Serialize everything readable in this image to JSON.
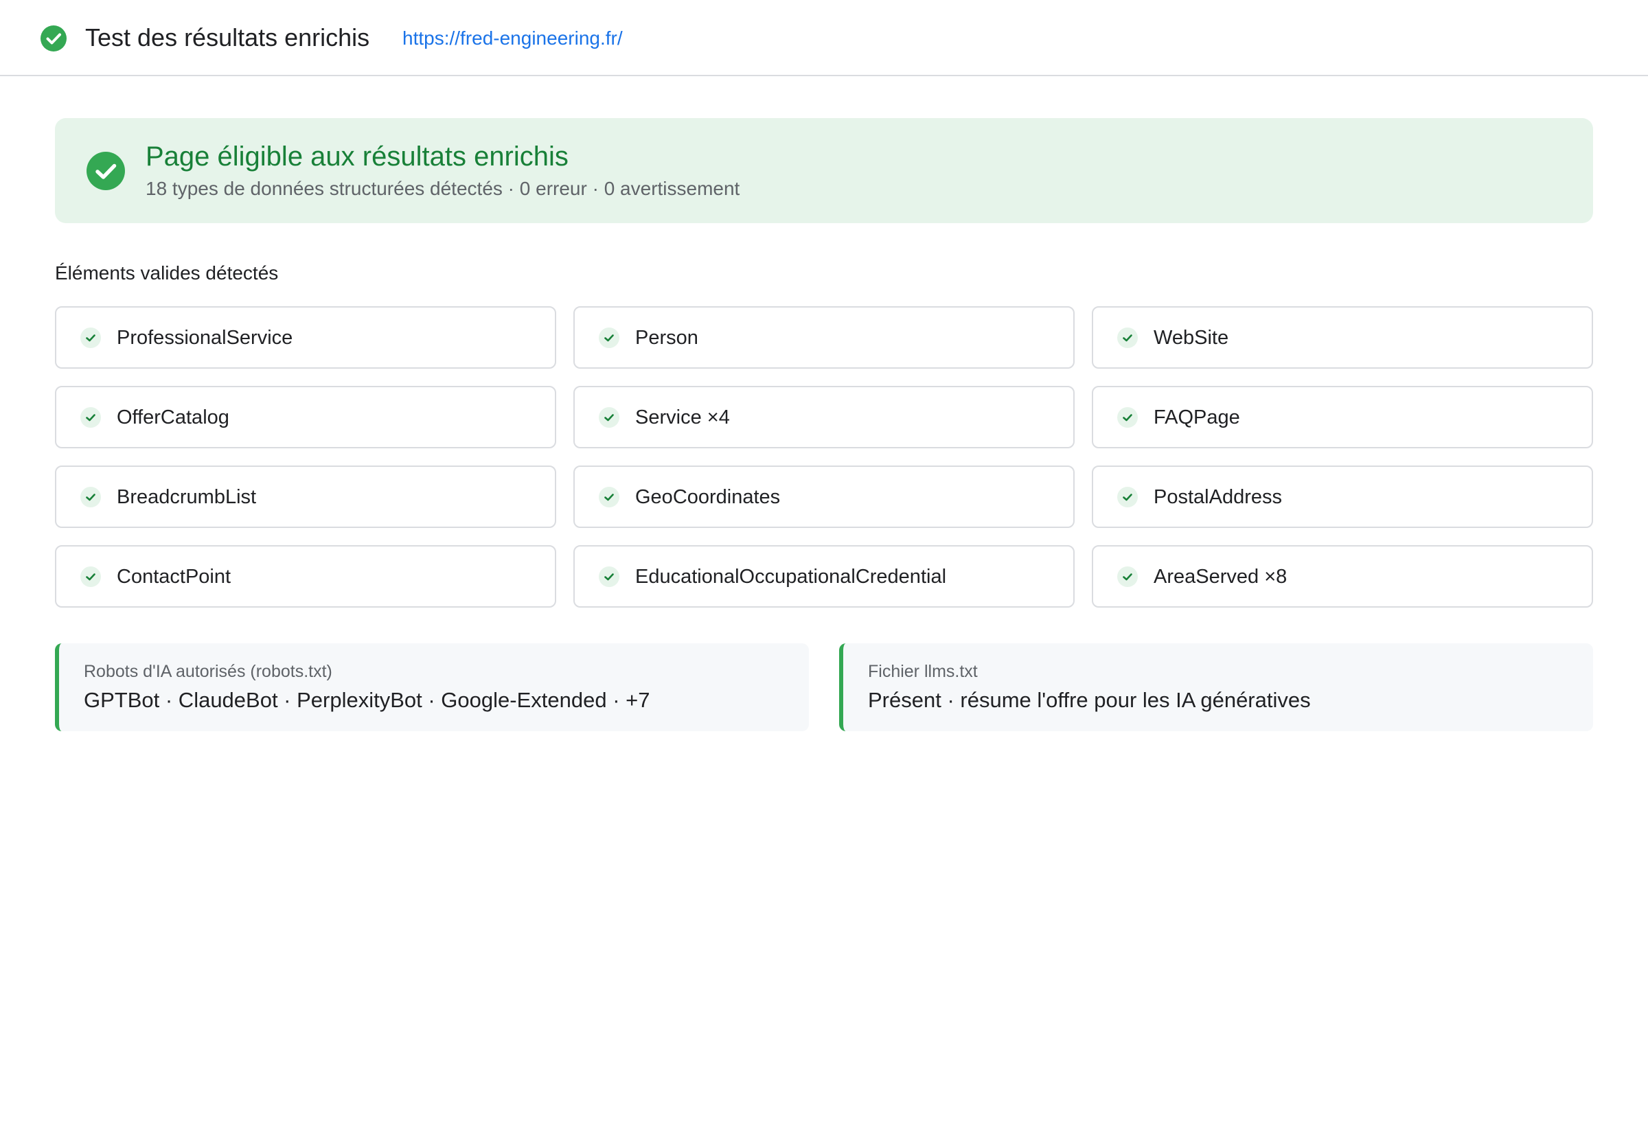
{
  "header": {
    "title": "Test des résultats enrichis",
    "url": "https://fred-engineering.fr/"
  },
  "banner": {
    "title": "Page éligible aux résultats enrichis",
    "subtitle": "18 types de données structurées détectés · 0 erreur · 0 avertissement"
  },
  "section": {
    "heading": "Éléments valides détectés"
  },
  "items": [
    {
      "label": "ProfessionalService"
    },
    {
      "label": "Person"
    },
    {
      "label": "WebSite"
    },
    {
      "label": "OfferCatalog"
    },
    {
      "label": "Service ×4"
    },
    {
      "label": "FAQPage"
    },
    {
      "label": "BreadcrumbList"
    },
    {
      "label": "GeoCoordinates"
    },
    {
      "label": "PostalAddress"
    },
    {
      "label": "ContactPoint"
    },
    {
      "label": "EducationalOccupationalCredential"
    },
    {
      "label": "AreaServed ×8"
    }
  ],
  "robots_card": {
    "label": "Robots d'IA autorisés (robots.txt)",
    "value": "GPTBot · ClaudeBot · PerplexityBot · Google-Extended · +7"
  },
  "llms_card": {
    "label": "Fichier llms.txt",
    "value": "Présent · résume l'offre pour les IA génératives"
  },
  "colors": {
    "success": "#34a853",
    "success_text": "#188038",
    "banner_bg": "#e6f4ea",
    "link": "#1a73e8"
  },
  "icons": {
    "status": "check-circle-icon"
  }
}
